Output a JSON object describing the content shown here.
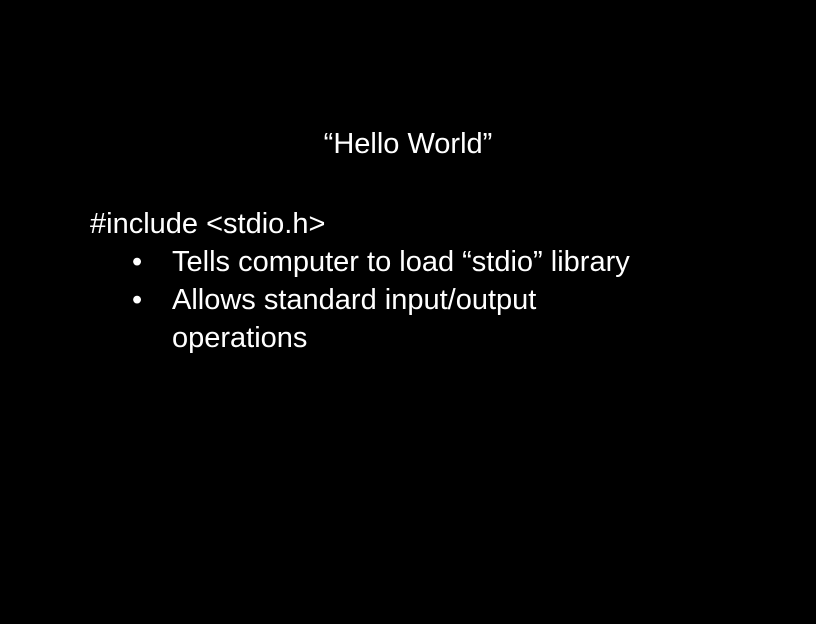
{
  "slide": {
    "title": "“Hello World”",
    "code_line": "#include <stdio.h>",
    "bullet_glyph": "•",
    "bullets": [
      {
        "text": "Tells computer to load “stdio” library"
      },
      {
        "text": "Allows standard input/output operations"
      }
    ]
  }
}
